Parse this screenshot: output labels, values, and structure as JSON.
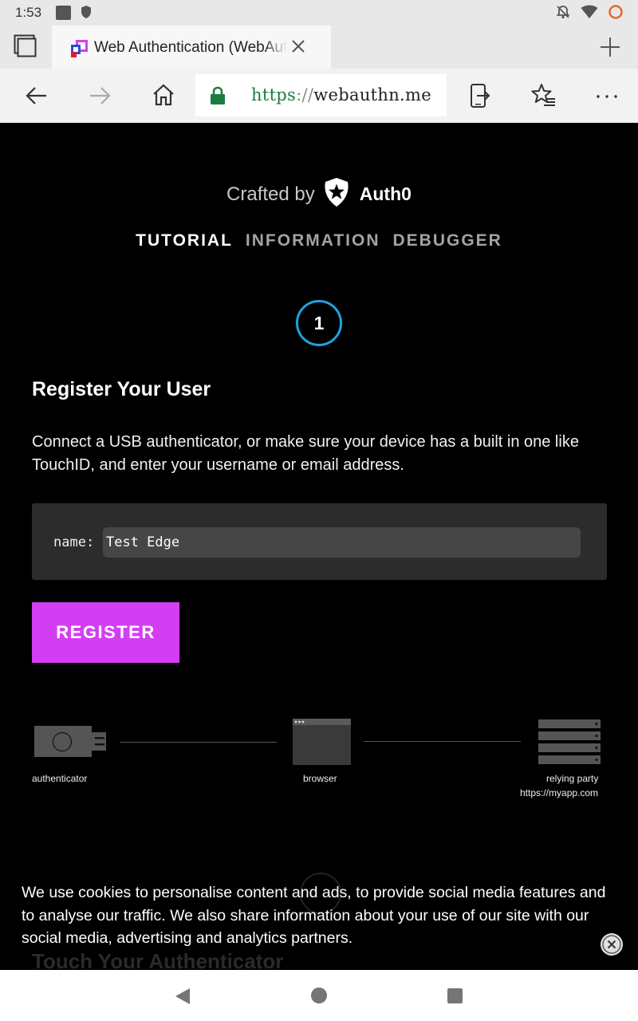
{
  "status_bar": {
    "time": "1:53",
    "icons": [
      "notification-square-icon",
      "shield-icon",
      "notifications-off-icon",
      "wifi-icon",
      "battery-ring-icon"
    ]
  },
  "browser": {
    "tab_title": "Web Authentication (WebAuthn)",
    "url_scheme": "https",
    "url_separator": "://",
    "url_host": "webauthn.me",
    "icons": [
      "tabs-icon",
      "close-icon",
      "new-tab-icon",
      "back-icon",
      "forward-icon",
      "home-icon",
      "lock-icon",
      "send-to-device-icon",
      "favorites-icon",
      "more-icon"
    ]
  },
  "header": {
    "crafted_by": "Crafted by",
    "brand": "Auth0"
  },
  "nav": {
    "tutorial": "TUTORIAL",
    "information": "INFORMATION",
    "debugger": "DEBUGGER"
  },
  "step": {
    "number": "1",
    "title": "Register Your User",
    "description": "Connect a USB authenticator, or make sure your device has a built in one like TouchID, and enter your username or email address."
  },
  "form": {
    "name_label": "name:",
    "name_value": "Test Edge",
    "register_label": "REGISTER"
  },
  "diagram": {
    "authenticator": "authenticator",
    "browser": "browser",
    "relying_party": "relying party",
    "relying_party_url": "https://myapp.com"
  },
  "next_step": {
    "title": "Touch Your Authenticator"
  },
  "cookie": {
    "text": "We use cookies to personalise content and ads, to provide social media features and to analyse our traffic. We also share information about your use of our site with our social media, advertising and analytics partners."
  },
  "colors": {
    "accent_register": "#d43ef2",
    "step_ring": "#1ea4e0",
    "url_scheme": "#1a7d3e",
    "lock": "#1a7d3e"
  }
}
